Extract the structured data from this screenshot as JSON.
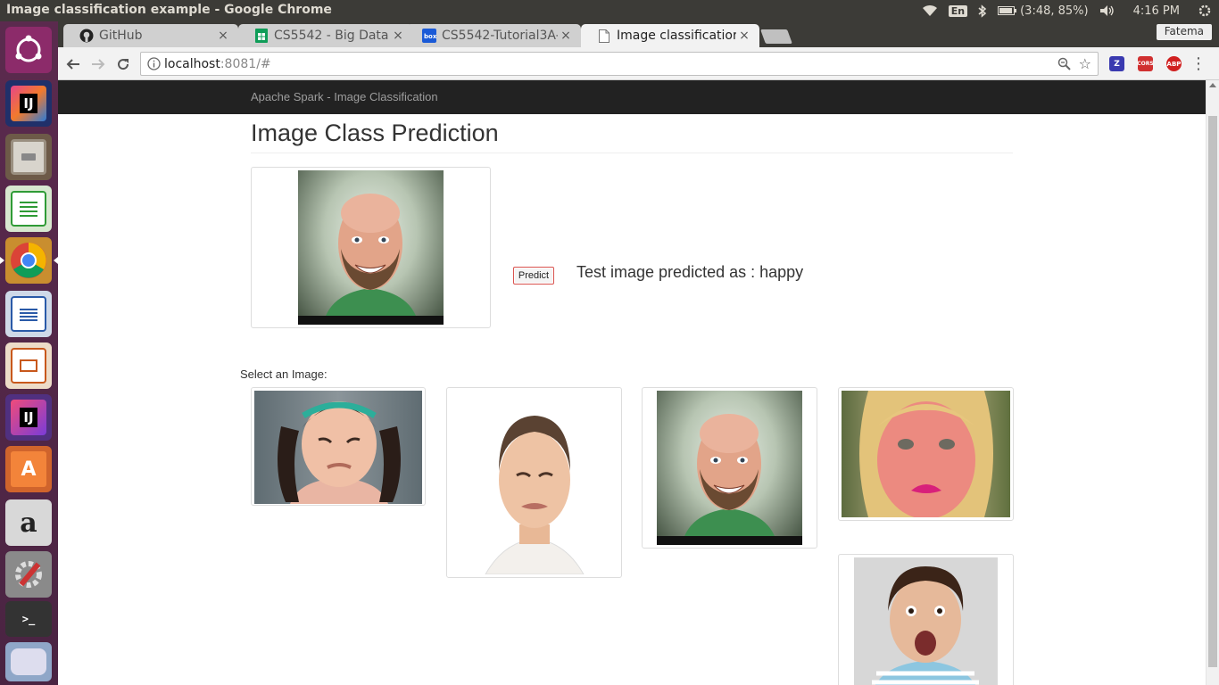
{
  "window": {
    "title": "Image classification example - Google Chrome"
  },
  "system_tray": {
    "keyboard_layout": "En",
    "battery": "(3:48, 85%)",
    "clock": "4:16 PM"
  },
  "browser": {
    "tabs": [
      {
        "title": "GitHub",
        "favicon": "github-icon",
        "close": "×"
      },
      {
        "title": "CS5542 - Big Data A",
        "favicon": "sheets-icon",
        "close": "×"
      },
      {
        "title": "CS5542-Tutorial3A-",
        "favicon": "box-icon",
        "close": "×"
      },
      {
        "title": "Image classificatior",
        "favicon": "page-icon",
        "close": "×",
        "active": true
      }
    ],
    "profile_name": "Fatema",
    "url_host": "localhost",
    "url_rest": ":8081/#",
    "extensions": [
      {
        "name": "zotero",
        "label": "Z",
        "color": "#3a3ab0"
      },
      {
        "name": "cors",
        "label": "CORS",
        "color": "#d03030"
      },
      {
        "name": "adblock",
        "label": "ABP",
        "color": "#d02020"
      }
    ]
  },
  "page": {
    "brand": "Apache Spark - Image Classification",
    "heading": "Image Class Prediction",
    "predict_button": "Predict",
    "prediction_text": "Test image predicted as : happy",
    "select_label": "Select an Image:"
  }
}
